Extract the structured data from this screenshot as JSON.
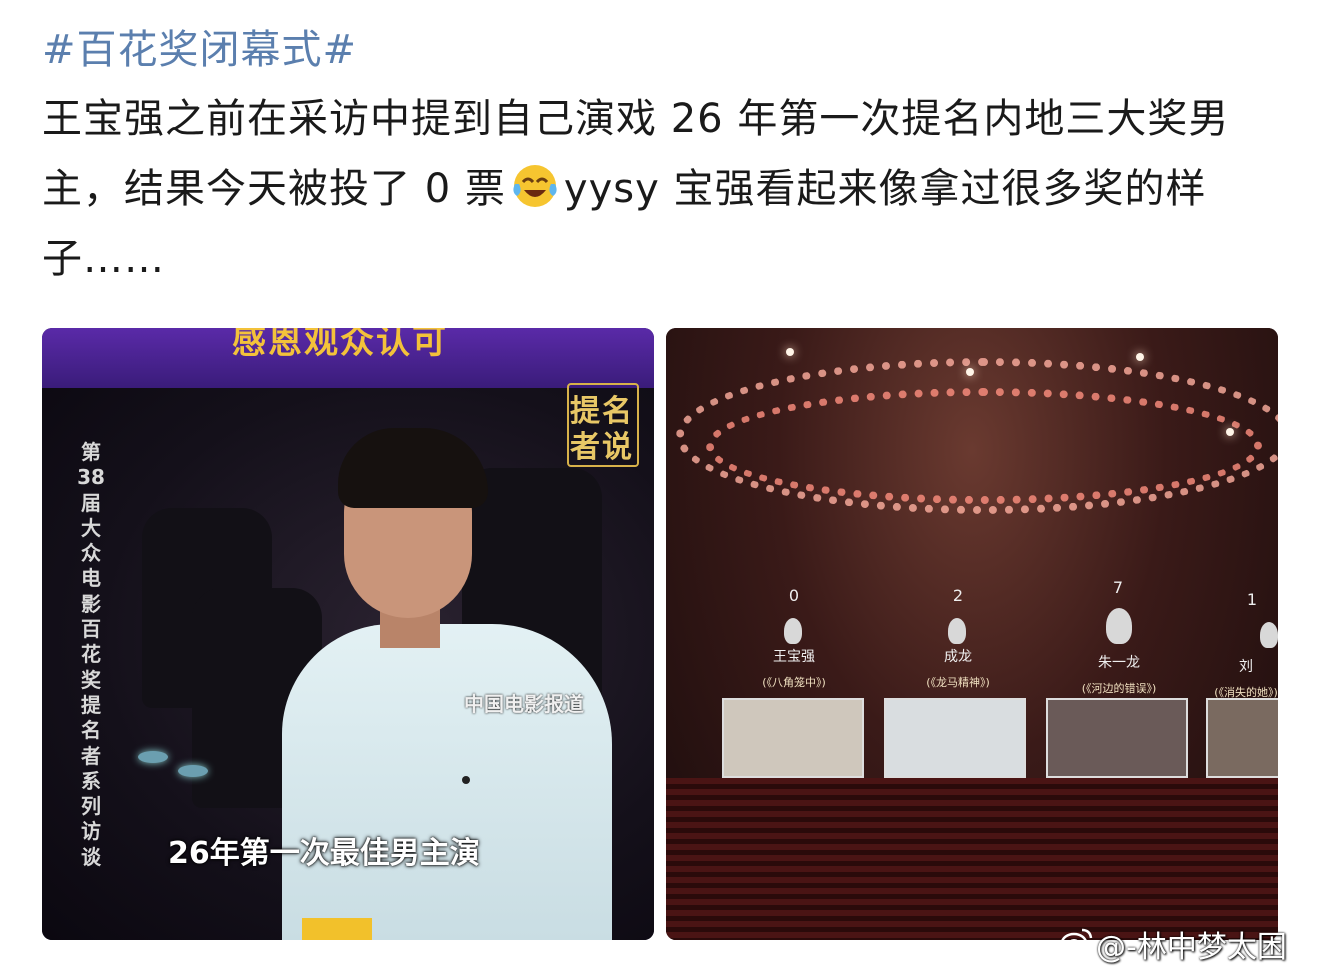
{
  "post": {
    "hashtag": "#百花奖闭幕式#",
    "text_before_emoji": "王宝强之前在采访中提到自己演戏 26 年第一次提名内地三大奖男主，结果今天被投了 0 票",
    "emoji": "laughing-crying-emoji",
    "text_after_emoji": "yysy 宝强看起来像拿过很多奖的样子……"
  },
  "left_image": {
    "top_banner": "感恩观众认可",
    "vertical_title": "第38届大众电影百花奖提名者系列访谈",
    "logo_chars": [
      "提",
      "名",
      "者",
      "说"
    ],
    "source_watermark": "中国电影报道",
    "subtitle": "26年第一次最佳男主演"
  },
  "right_image": {
    "nominees": [
      {
        "votes": "0",
        "name": "王宝强",
        "film": "(《八角笼中》)"
      },
      {
        "votes": "2",
        "name": "成龙",
        "film": "(《龙马精神》)"
      },
      {
        "votes": "7",
        "name": "朱一龙",
        "film": "(《河边的错误》)"
      },
      {
        "votes": "1",
        "name": "刘",
        "film": "(《消失的她》)"
      }
    ]
  },
  "watermark": "@-林中梦太困",
  "colors": {
    "hashtag": "#5b7fae",
    "text": "#1a1a1a",
    "gold": "#e8c766",
    "background": "#ffffff"
  }
}
